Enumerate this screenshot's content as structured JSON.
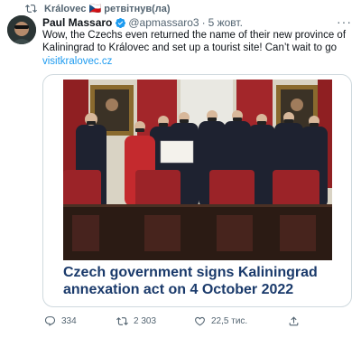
{
  "retweet": {
    "text": "Královec 🇨🇿 ретвітнув(ла)"
  },
  "tweet": {
    "author_name": "Paul Massaro",
    "author_handle": "@apmassaro3",
    "separator": "·",
    "date": "5 жовт.",
    "text": "Wow, the Czechs even returned the name of their new province of Kaliningrad to Královec and set up a tourist site! Can’t wait to go",
    "link": "visitkralovec.cz"
  },
  "card": {
    "title": "Czech government signs Kaliningrad annexation act on 4 October 2022",
    "signed_document_label": ""
  },
  "actions": {
    "replies": "334",
    "retweets": "2 303",
    "likes": "22,5 тис."
  },
  "colors": {
    "link": "#1d9bf0",
    "card_title": "#1a3a6b",
    "verified": "#1d9bf0",
    "muted": "#536471"
  },
  "icons": {
    "retweet": "retweet-icon",
    "verified": "verified-badge-icon",
    "reply": "reply-icon",
    "like": "heart-icon",
    "share": "share-icon",
    "more": "more-icon"
  }
}
